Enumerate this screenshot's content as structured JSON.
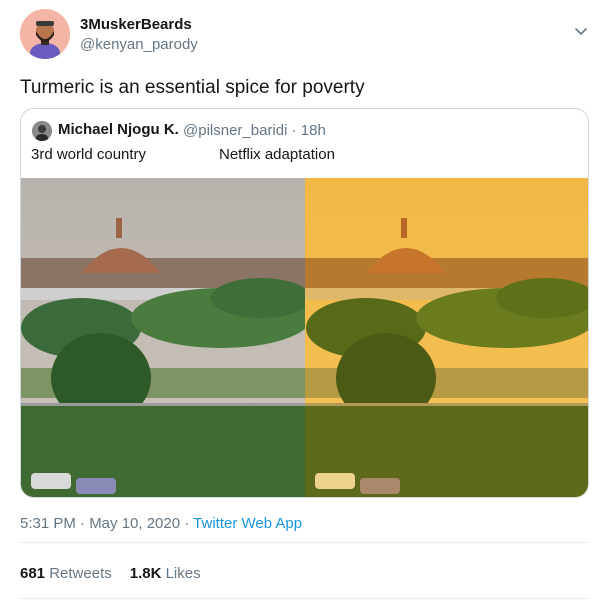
{
  "author": {
    "display_name": "3MuskerBeards",
    "handle": "@kenyan_parody"
  },
  "tweet": {
    "text": "Turmeric is an essential spice for poverty"
  },
  "quoted": {
    "display_name": "Michael Njogu K.",
    "handle_time": "@pilsner_baridi · 18h",
    "text_left": "3rd world country",
    "text_right": "Netflix adaptation"
  },
  "meta": {
    "time": "5:31 PM · May 10, 2020 · ",
    "app": "Twitter Web App"
  },
  "stats": {
    "retweets_count": "681",
    "retweets_label": "Retweets",
    "likes_count": "1.8K",
    "likes_label": "Likes"
  },
  "icons": {
    "caret": "chevron-down-icon"
  },
  "colors": {
    "link": "#1b95e0",
    "secondary_text": "#657786",
    "border": "#ccd6dd"
  }
}
